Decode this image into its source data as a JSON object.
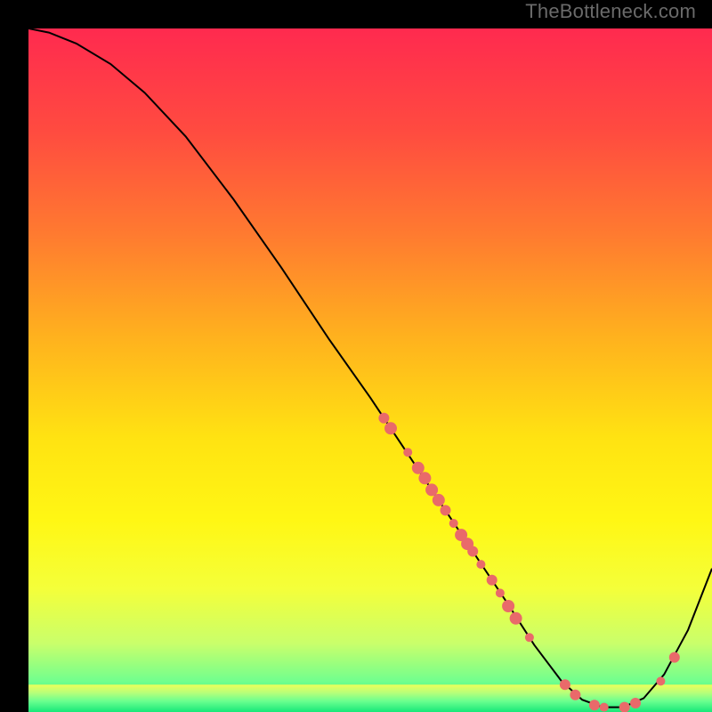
{
  "watermark": "TheBottleneck.com",
  "chart_data": {
    "type": "line",
    "title": "",
    "xlabel": "",
    "ylabel": "",
    "xlim": [
      0,
      100
    ],
    "ylim": [
      0,
      100
    ],
    "grid": false,
    "legend": false,
    "background_gradient": {
      "stops": [
        {
          "offset": 0.0,
          "color": "#ff2a4f"
        },
        {
          "offset": 0.15,
          "color": "#ff4b40"
        },
        {
          "offset": 0.3,
          "color": "#ff7a30"
        },
        {
          "offset": 0.45,
          "color": "#ffb11e"
        },
        {
          "offset": 0.6,
          "color": "#ffe312"
        },
        {
          "offset": 0.72,
          "color": "#fff714"
        },
        {
          "offset": 0.82,
          "color": "#f4ff3a"
        },
        {
          "offset": 0.9,
          "color": "#c9ff6b"
        },
        {
          "offset": 0.955,
          "color": "#71ff8e"
        },
        {
          "offset": 1.0,
          "color": "#19e87a"
        }
      ]
    },
    "bottom_band": {
      "y_start": 96,
      "y_end": 100,
      "stops": [
        {
          "offset": 0.0,
          "color": "#ecff5a"
        },
        {
          "offset": 0.3,
          "color": "#b6ff7a"
        },
        {
          "offset": 0.6,
          "color": "#6bff8f"
        },
        {
          "offset": 1.0,
          "color": "#17e879"
        }
      ]
    },
    "series": [
      {
        "name": "curve",
        "type": "line",
        "color": "#000000",
        "width": 2.0,
        "points": [
          {
            "x": 0.0,
            "y": 100.0
          },
          {
            "x": 3.0,
            "y": 99.4
          },
          {
            "x": 7.0,
            "y": 97.8
          },
          {
            "x": 12.0,
            "y": 94.8
          },
          {
            "x": 17.0,
            "y": 90.6
          },
          {
            "x": 23.0,
            "y": 84.2
          },
          {
            "x": 30.0,
            "y": 75.0
          },
          {
            "x": 37.0,
            "y": 65.0
          },
          {
            "x": 44.0,
            "y": 54.5
          },
          {
            "x": 50.0,
            "y": 46.0
          },
          {
            "x": 55.0,
            "y": 38.5
          },
          {
            "x": 60.0,
            "y": 31.0
          },
          {
            "x": 65.0,
            "y": 23.5
          },
          {
            "x": 70.0,
            "y": 16.0
          },
          {
            "x": 74.0,
            "y": 9.8
          },
          {
            "x": 78.0,
            "y": 4.5
          },
          {
            "x": 81.0,
            "y": 1.8
          },
          {
            "x": 84.0,
            "y": 0.7
          },
          {
            "x": 87.0,
            "y": 0.7
          },
          {
            "x": 90.0,
            "y": 2.0
          },
          {
            "x": 93.0,
            "y": 5.5
          },
          {
            "x": 96.5,
            "y": 12.0
          },
          {
            "x": 100.0,
            "y": 21.0
          }
        ]
      },
      {
        "name": "points-along-curve",
        "type": "scatter",
        "color": "#e96a6a",
        "radius_small": 5,
        "radius_large": 7,
        "points": [
          {
            "x": 52.0,
            "y": 43.0,
            "r": 6
          },
          {
            "x": 53.0,
            "y": 41.5,
            "r": 7
          },
          {
            "x": 55.5,
            "y": 38.0,
            "r": 5
          },
          {
            "x": 57.0,
            "y": 35.7,
            "r": 7
          },
          {
            "x": 58.0,
            "y": 34.2,
            "r": 7
          },
          {
            "x": 59.0,
            "y": 32.5,
            "r": 7
          },
          {
            "x": 60.0,
            "y": 31.0,
            "r": 7
          },
          {
            "x": 61.0,
            "y": 29.5,
            "r": 6
          },
          {
            "x": 62.2,
            "y": 27.6,
            "r": 5
          },
          {
            "x": 63.3,
            "y": 25.9,
            "r": 7
          },
          {
            "x": 64.2,
            "y": 24.6,
            "r": 7
          },
          {
            "x": 65.0,
            "y": 23.5,
            "r": 6
          },
          {
            "x": 66.2,
            "y": 21.6,
            "r": 5
          },
          {
            "x": 67.8,
            "y": 19.3,
            "r": 6
          },
          {
            "x": 69.0,
            "y": 17.4,
            "r": 5
          },
          {
            "x": 70.2,
            "y": 15.5,
            "r": 7
          },
          {
            "x": 71.3,
            "y": 13.7,
            "r": 7
          },
          {
            "x": 73.3,
            "y": 10.9,
            "r": 5
          },
          {
            "x": 78.5,
            "y": 4.0,
            "r": 6
          },
          {
            "x": 80.0,
            "y": 2.5,
            "r": 6
          },
          {
            "x": 82.8,
            "y": 1.0,
            "r": 6
          },
          {
            "x": 84.2,
            "y": 0.7,
            "r": 5
          },
          {
            "x": 87.2,
            "y": 0.7,
            "r": 6
          },
          {
            "x": 88.8,
            "y": 1.3,
            "r": 6
          },
          {
            "x": 92.5,
            "y": 4.5,
            "r": 5
          },
          {
            "x": 94.5,
            "y": 8.0,
            "r": 6
          }
        ]
      }
    ]
  }
}
